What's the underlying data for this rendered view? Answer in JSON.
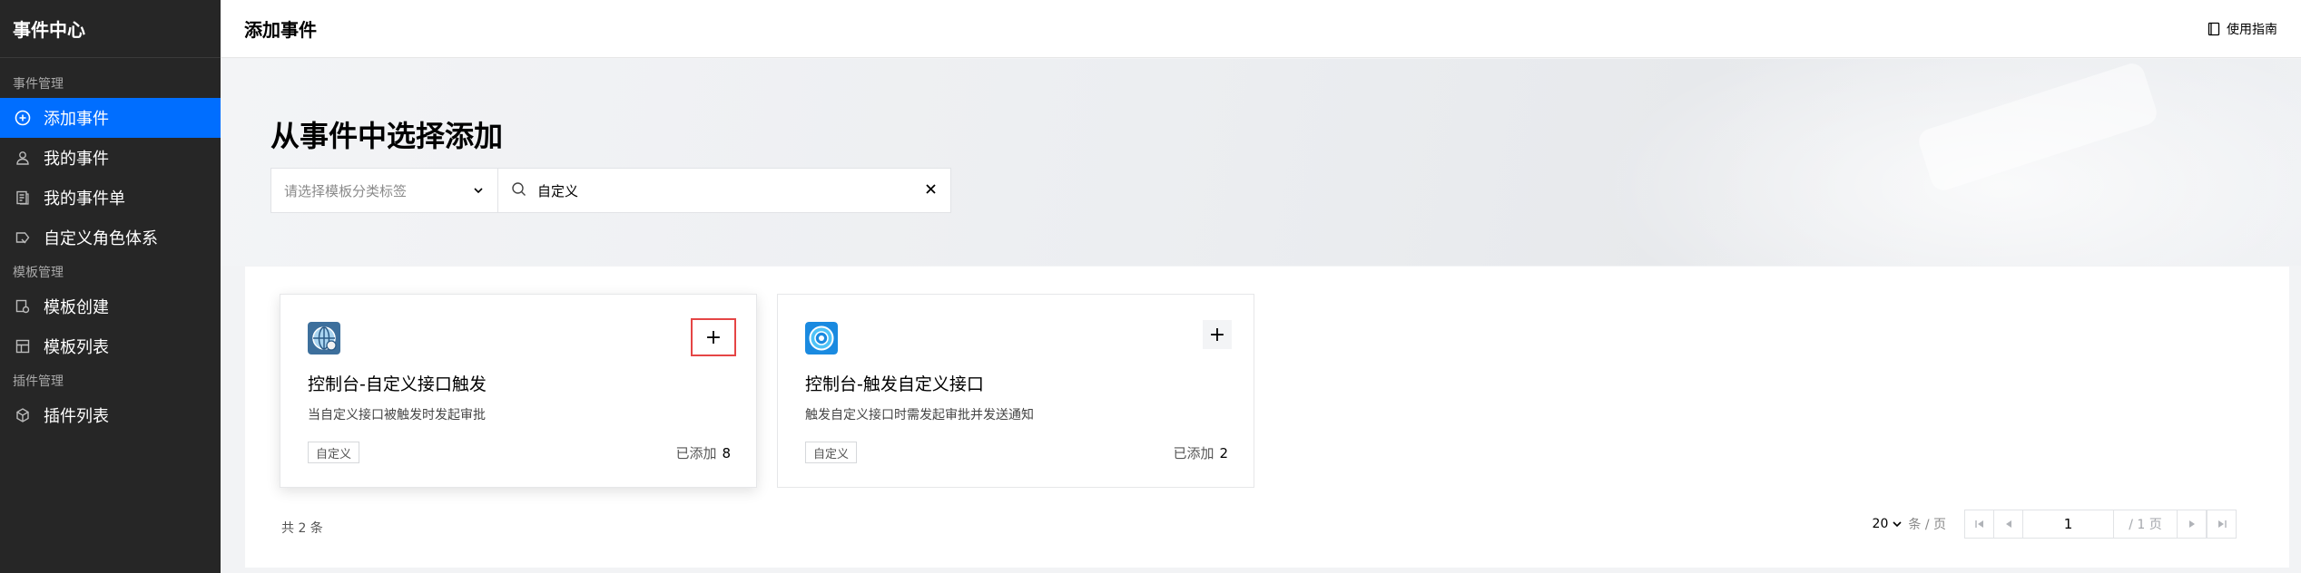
{
  "sidebar": {
    "brand": "事件中心",
    "groups": [
      {
        "title": "事件管理",
        "items": [
          {
            "label": "添加事件",
            "icon": "add-circle-icon",
            "active": true
          },
          {
            "label": "我的事件",
            "icon": "user-icon"
          },
          {
            "label": "我的事件单",
            "icon": "document-list-icon"
          },
          {
            "label": "自定义角色体系",
            "icon": "role-tag-icon"
          }
        ]
      },
      {
        "title": "模板管理",
        "items": [
          {
            "label": "模板创建",
            "icon": "template-create-icon"
          },
          {
            "label": "模板列表",
            "icon": "template-list-icon"
          }
        ]
      },
      {
        "title": "插件管理",
        "items": [
          {
            "label": "插件列表",
            "icon": "cube-icon"
          }
        ]
      }
    ]
  },
  "topbar": {
    "title": "添加事件",
    "guide_label": "使用指南"
  },
  "hero": {
    "heading": "从事件中选择添加"
  },
  "filter": {
    "select_placeholder": "请选择模板分类标签",
    "search_value": "自定义"
  },
  "cards": [
    {
      "name": "控制台-自定义接口触发",
      "desc": "当自定义接口被触发时发起审批",
      "tag": "自定义",
      "added_label": "已添加",
      "added_count": "8",
      "add_label": "+",
      "icon": "globe-app-icon"
    },
    {
      "name": "控制台-触发自定义接口",
      "desc": "触发自定义接口时需发起审批并发送通知",
      "tag": "自定义",
      "added_label": "已添加",
      "added_count": "2",
      "add_label": "+",
      "icon": "circle-app-icon"
    }
  ],
  "footer": {
    "total": "共 2 条",
    "page_size": "20",
    "page_size_unit": "条 / 页",
    "current_page": "1",
    "total_pages": "/ 1 页"
  },
  "colors": {
    "accent": "#006eff",
    "sidebar_bg": "#262626",
    "highlight_border": "#e54545"
  }
}
